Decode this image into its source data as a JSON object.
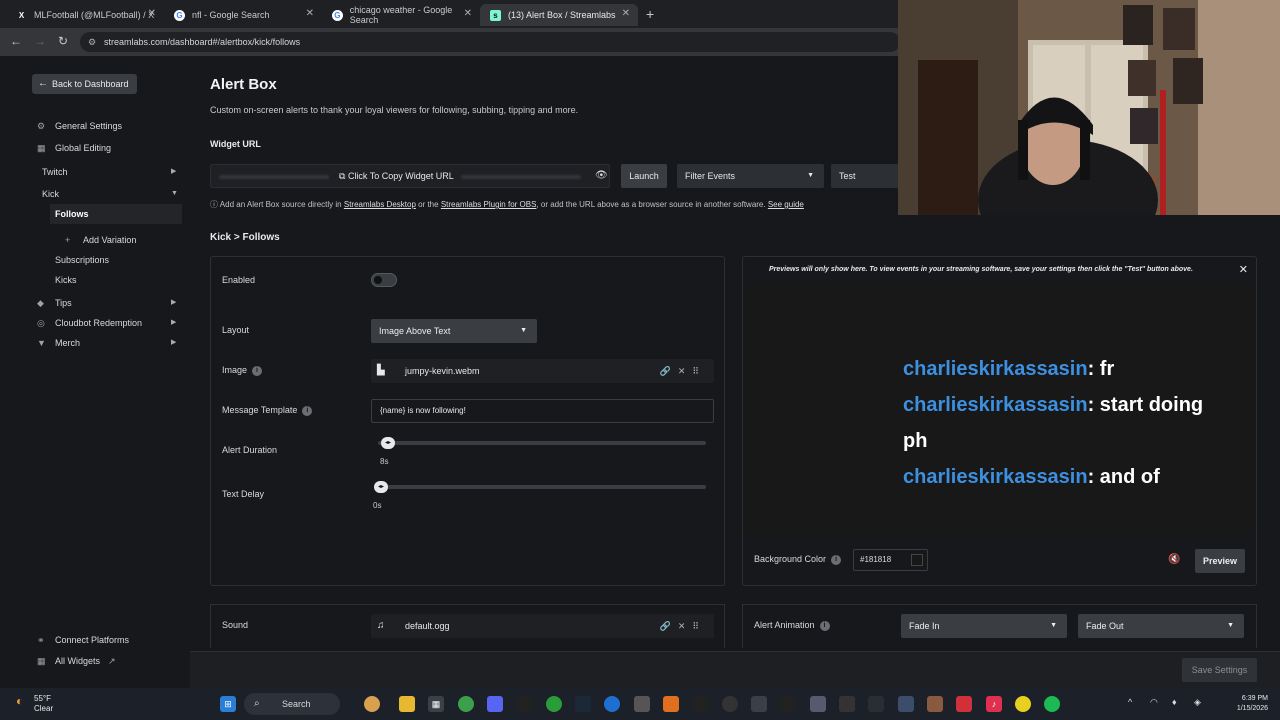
{
  "browser": {
    "tabs": [
      {
        "title": "MLFootball (@MLFootball) / X",
        "icon": "x-logo"
      },
      {
        "title": "nfl - Google Search",
        "icon": "google-logo"
      },
      {
        "title": "chicago weather - Google Search",
        "icon": "google-logo"
      },
      {
        "title": "(13) Alert Box / Streamlabs",
        "icon": "streamlabs-logo"
      }
    ],
    "url": "streamlabs.com/dashboard#/alertbox/kick/follows"
  },
  "sidebar": {
    "back_label": "Back to Dashboard",
    "general_settings": "General Settings",
    "global_editing": "Global Editing",
    "twitch": "Twitch",
    "kick": "Kick",
    "follows": "Follows",
    "add_variation": "Add Variation",
    "subscriptions": "Subscriptions",
    "kicks": "Kicks",
    "tips": "Tips",
    "cloudbot": "Cloudbot Redemption",
    "merch": "Merch",
    "connect_platforms": "Connect Platforms",
    "all_widgets": "All Widgets"
  },
  "main": {
    "title": "Alert Box",
    "description": "Custom on-screen alerts to thank your loyal viewers for following, subbing, tipping and more.",
    "widget_url_label": "Widget URL",
    "copy_url_label": "Click To Copy Widget URL",
    "launch_label": "Launch",
    "filter_events_label": "Filter Events",
    "test_label": "Test",
    "info": {
      "prefix": "Add an Alert Box source directly in",
      "link1": "Streamlabs Desktop",
      "mid": "or the",
      "link2": "Streamlabs Plugin for OBS",
      "suffix": ", or add the URL above as a browser source in another software.",
      "link3": "See guide"
    },
    "breadcrumb": "Kick > Follows"
  },
  "settings": {
    "enabled_label": "Enabled",
    "enabled": false,
    "layout_label": "Layout",
    "layout_value": "Image Above Text",
    "image_label": "Image",
    "image_file": "jumpy-kevin.webm",
    "message_label": "Message Template",
    "message_value": "{name} is now following!",
    "duration_label": "Alert Duration",
    "duration_value": "8s",
    "duration_fraction": 0.0,
    "delay_label": "Text Delay",
    "delay_value": "0s",
    "delay_fraction": 0.0,
    "sound_label": "Sound",
    "sound_file": "default.ogg"
  },
  "preview": {
    "banner": "Previews will only show here. To view events in your streaming software, save your settings then click the \"Test\" button above.",
    "chat": [
      {
        "name": "charlieskirkassasin",
        "text": ": fr"
      },
      {
        "name": "charlieskirkassasin",
        "text": ": start doing"
      },
      {
        "name": "",
        "text": "ph"
      },
      {
        "name": "charlieskirkassasin",
        "text": ": and of"
      }
    ],
    "bg_label": "Background Color",
    "bg_value": "#181818",
    "preview_label": "Preview",
    "animation_label": "Alert Animation",
    "anim_in": "Fade In",
    "anim_out": "Fade Out"
  },
  "save_label": "Save Settings",
  "taskbar": {
    "temp": "55°F",
    "condition": "Clear",
    "search_label": "Search",
    "time": "6:39 PM",
    "date": "1/15/2026"
  },
  "colors": {
    "accent_name": "#3d8fe0",
    "bg": "#17181b"
  }
}
